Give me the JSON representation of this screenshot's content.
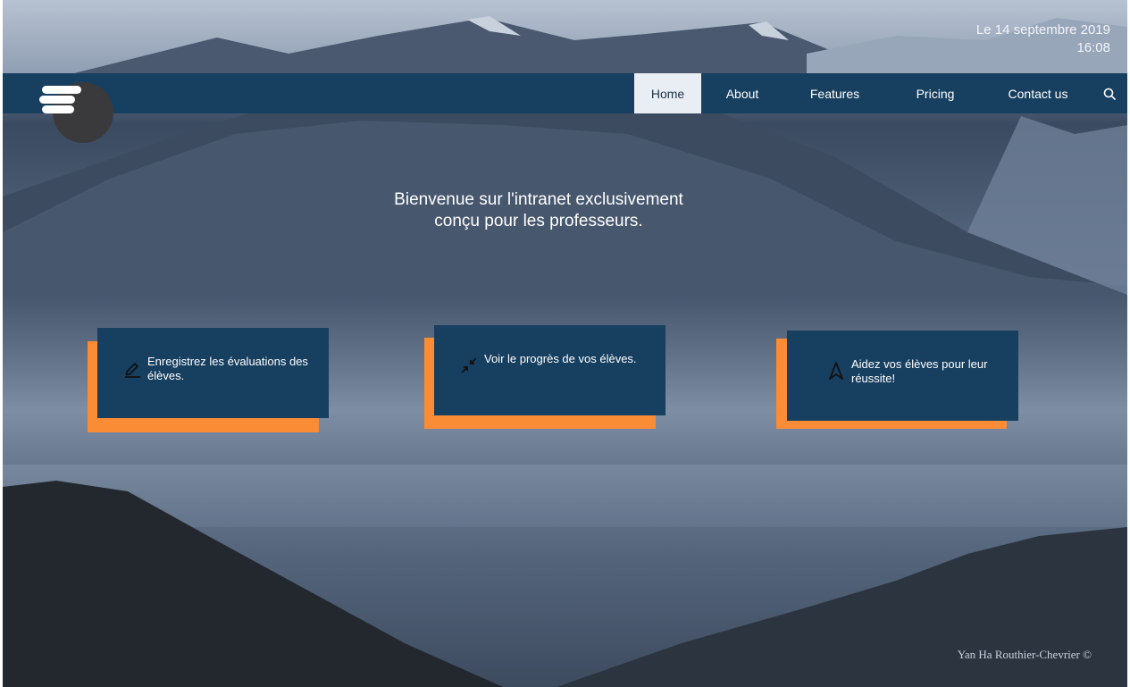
{
  "datetime": {
    "date": "Le 14 septembre 2019",
    "time": "16:08"
  },
  "nav": {
    "items": [
      {
        "label": "Home",
        "active": true
      },
      {
        "label": "About"
      },
      {
        "label": "Features"
      },
      {
        "label": "Pricing"
      },
      {
        "label": "Contact us"
      }
    ],
    "search_icon": "search-icon"
  },
  "welcome": {
    "line1": "Bienvenue sur l'intranet exclusivement",
    "line2": "conçu pour les professeurs."
  },
  "cards": [
    {
      "icon": "pencil-icon",
      "text": "Enregistrez les évaluations des élèves."
    },
    {
      "icon": "compress-arrows-icon",
      "text": "Voir le progrès de vos élèves."
    },
    {
      "icon": "navigation-arrow-icon",
      "text": "Aidez vos élèves pour leur réussite!"
    }
  ],
  "footer": {
    "credit": "Yan Ha Routhier-Chevrier ©"
  },
  "colors": {
    "navbar": "#173f60",
    "accent": "#fb8c36",
    "active_tab": "#e9edf4"
  }
}
